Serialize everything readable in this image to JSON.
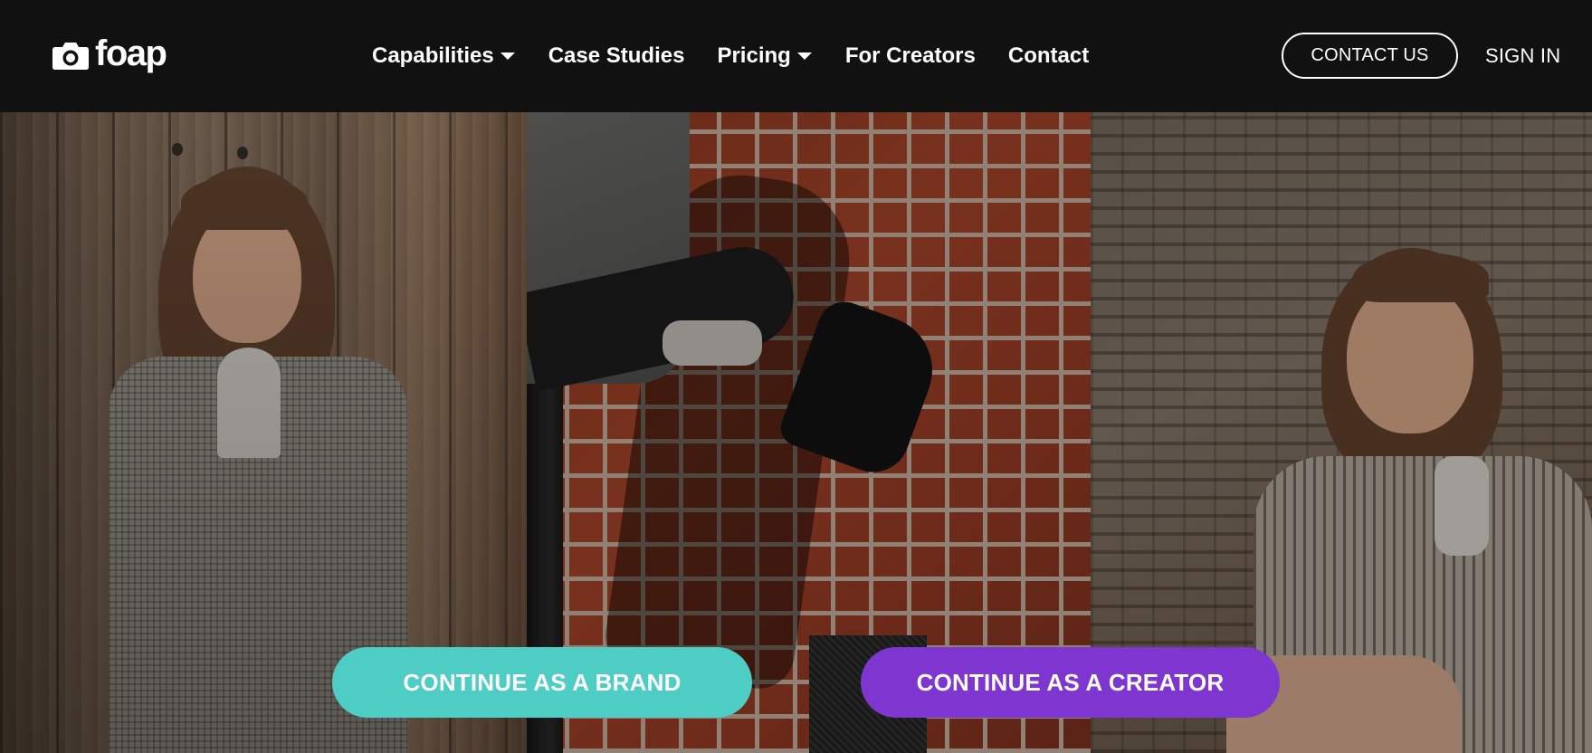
{
  "header": {
    "logo_text": "foap",
    "nav": [
      {
        "label": "Capabilities",
        "has_dropdown": true
      },
      {
        "label": "Case Studies",
        "has_dropdown": false
      },
      {
        "label": "Pricing",
        "has_dropdown": true
      },
      {
        "label": "For Creators",
        "has_dropdown": false
      },
      {
        "label": "Contact",
        "has_dropdown": false
      }
    ],
    "contact_button": "CONTACT US",
    "sign_in": "SIGN IN"
  },
  "hero": {
    "cta_brand": "CONTINUE AS A BRAND",
    "cta_creator": "CONTINUE AS A CREATOR"
  },
  "colors": {
    "header_bg": "#111111",
    "brand_button": "#4ecdc4",
    "creator_button": "#7f35d0",
    "text": "#ffffff"
  },
  "icons": {
    "logo": "camera-icon",
    "dropdown": "caret-down-icon"
  }
}
